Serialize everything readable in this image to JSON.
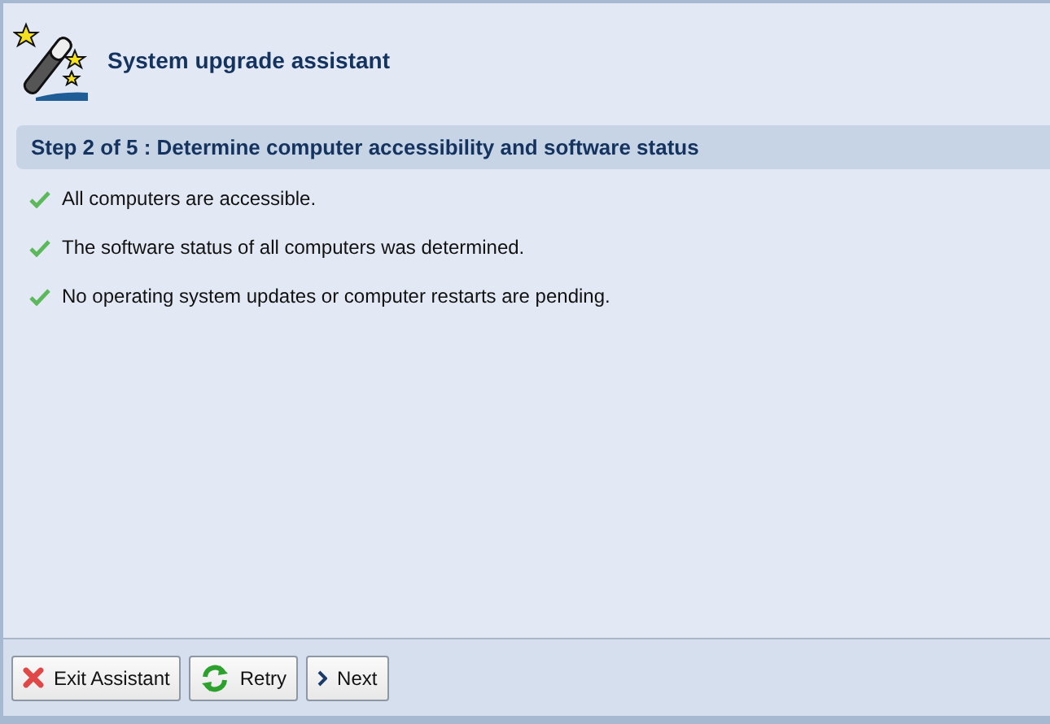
{
  "window": {
    "title": "System upgrade assistant"
  },
  "step": {
    "title": "Step 2 of 5 : Determine computer accessibility and software status"
  },
  "results": [
    {
      "kind": "success",
      "text": "All computers are accessible."
    },
    {
      "kind": "success",
      "text": "The software status of all computers was determined."
    },
    {
      "kind": "success",
      "text": "No operating system updates or computer restarts are pending."
    }
  ],
  "buttons": [
    {
      "kind": "exit",
      "label": "Exit Assistant"
    },
    {
      "kind": "retry",
      "label": "Retry"
    },
    {
      "kind": "next",
      "label": "Next"
    }
  ]
}
